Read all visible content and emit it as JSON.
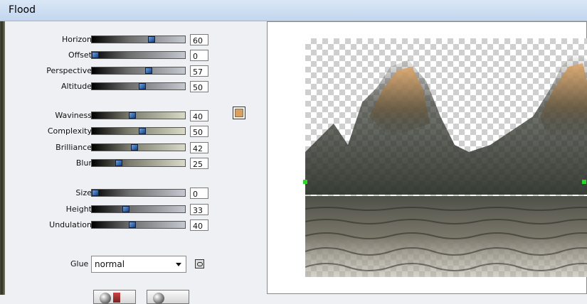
{
  "window": {
    "title": "Flood"
  },
  "sliders": [
    {
      "label": "Horizon",
      "value": "60",
      "fraction": 0.6,
      "top": 0
    },
    {
      "label": "Offset",
      "value": "0",
      "fraction": 0.0,
      "top": 0
    },
    {
      "label": "Perspective",
      "value": "57",
      "fraction": 0.57,
      "top": 0
    },
    {
      "label": "Altitude",
      "value": "50",
      "fraction": 0.5,
      "top": 0
    },
    {
      "label": "Waviness",
      "value": "40",
      "fraction": 0.4,
      "top": 0
    },
    {
      "label": "Complexity",
      "value": "50",
      "fraction": 0.5,
      "top": 0
    },
    {
      "label": "Brilliance",
      "value": "42",
      "fraction": 0.42,
      "top": 0
    },
    {
      "label": "Blur",
      "value": "25",
      "fraction": 0.25,
      "top": 0
    },
    {
      "label": "Size",
      "value": "0",
      "fraction": 0.0,
      "top": 0
    },
    {
      "label": "Height",
      "value": "33",
      "fraction": 0.33,
      "top": 0
    },
    {
      "label": "Undulation",
      "value": "40",
      "fraction": 0.4,
      "top": 0
    }
  ],
  "color_swatch": {
    "color": "#d9a064"
  },
  "glue": {
    "label": "Glue",
    "value": "normal"
  },
  "icons": {
    "link": "link-icon",
    "dropdown": "chevron-down-icon",
    "reset": "reset-icon",
    "preview": "preview-icon"
  }
}
